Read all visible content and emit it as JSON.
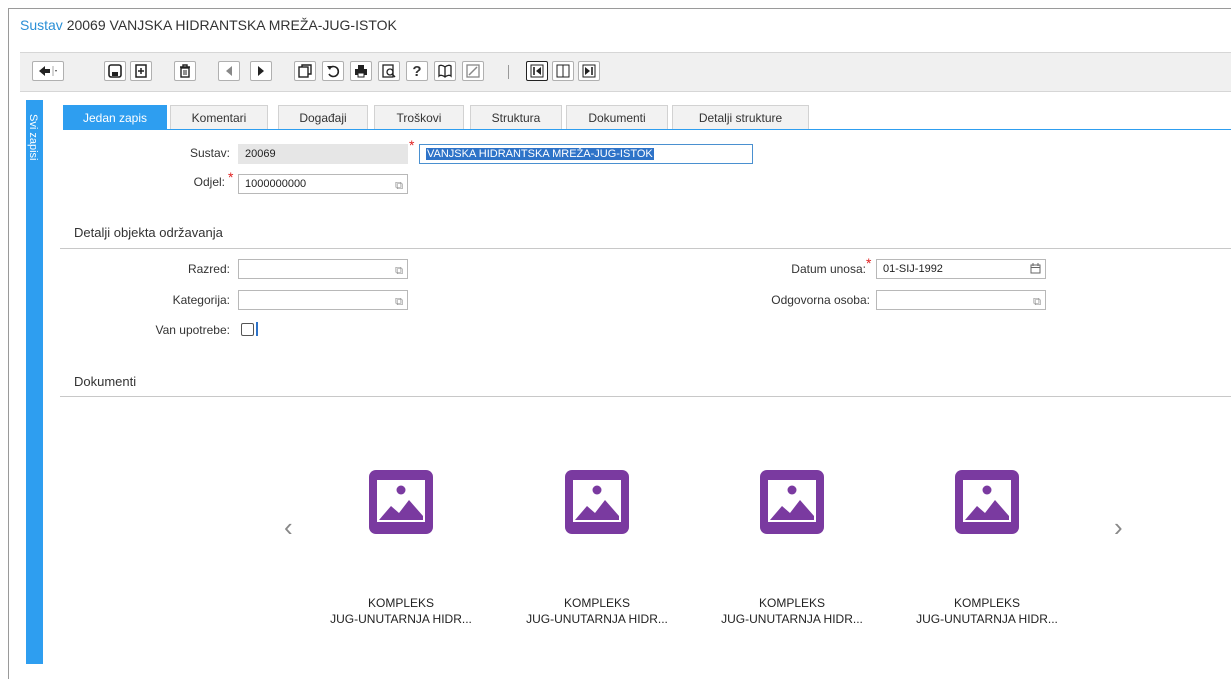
{
  "header": {
    "prefix": "Sustav",
    "record_id": "20069",
    "record_name": "VANJSKA HIDRANTSKA MREŽA-JUG-ISTOK"
  },
  "toolbar": {
    "icons": [
      "back-arrow-icon",
      "dropdown-chevron-icon",
      "save-icon",
      "new-record-icon",
      "delete-icon",
      "previous-icon",
      "next-icon",
      "copy-icon",
      "refresh-icon",
      "print-icon",
      "preview-icon",
      "help-icon",
      "book-icon",
      "clear-icon",
      "first-panel-icon",
      "split-panel-icon",
      "last-panel-icon"
    ],
    "help_glyph": "?"
  },
  "sidebar": {
    "label": "Svi zapisi"
  },
  "tabs": [
    {
      "label": "Jedan zapis",
      "active": true
    },
    {
      "label": "Komentari",
      "active": false
    },
    {
      "label": "Događaji",
      "active": false
    },
    {
      "label": "Troškovi",
      "active": false
    },
    {
      "label": "Struktura",
      "active": false
    },
    {
      "label": "Dokumenti",
      "active": false
    },
    {
      "label": "Detalji strukture",
      "active": false
    }
  ],
  "form": {
    "sustav_label": "Sustav:",
    "sustav_value": "20069",
    "name_value": "VANJSKA HIDRANTSKA MREŽA-JUG-ISTOK",
    "odjel_label": "Odjel:",
    "odjel_value": "1000000000"
  },
  "details": {
    "section_title": "Detalji objekta održavanja",
    "razred_label": "Razred:",
    "razred_value": "",
    "kategorija_label": "Kategorija:",
    "kategorija_value": "",
    "van_upotrebe_label": "Van upotrebe:",
    "van_upotrebe_checked": false,
    "datum_unosa_label": "Datum unosa:",
    "datum_unosa_value": "01-SIJ-1992",
    "odgovorna_osoba_label": "Odgovorna osoba:",
    "odgovorna_osoba_value": ""
  },
  "documents": {
    "section_title": "Dokumenti",
    "prev_glyph": "‹",
    "next_glyph": "›",
    "items": [
      {
        "line1": "KOMPLEKS",
        "line2": "JUG-UNUTARNJA HIDR..."
      },
      {
        "line1": "KOMPLEKS",
        "line2": "JUG-UNUTARNJA HIDR..."
      },
      {
        "line1": "KOMPLEKS",
        "line2": "JUG-UNUTARNJA HIDR..."
      },
      {
        "line1": "KOMPLEKS",
        "line2": "JUG-UNUTARNJA HIDR..."
      }
    ]
  },
  "colors": {
    "accent": "#2e9ef0",
    "thumb": "#7a3aa0",
    "required": "#e02020",
    "selection": "#2e73c8"
  }
}
